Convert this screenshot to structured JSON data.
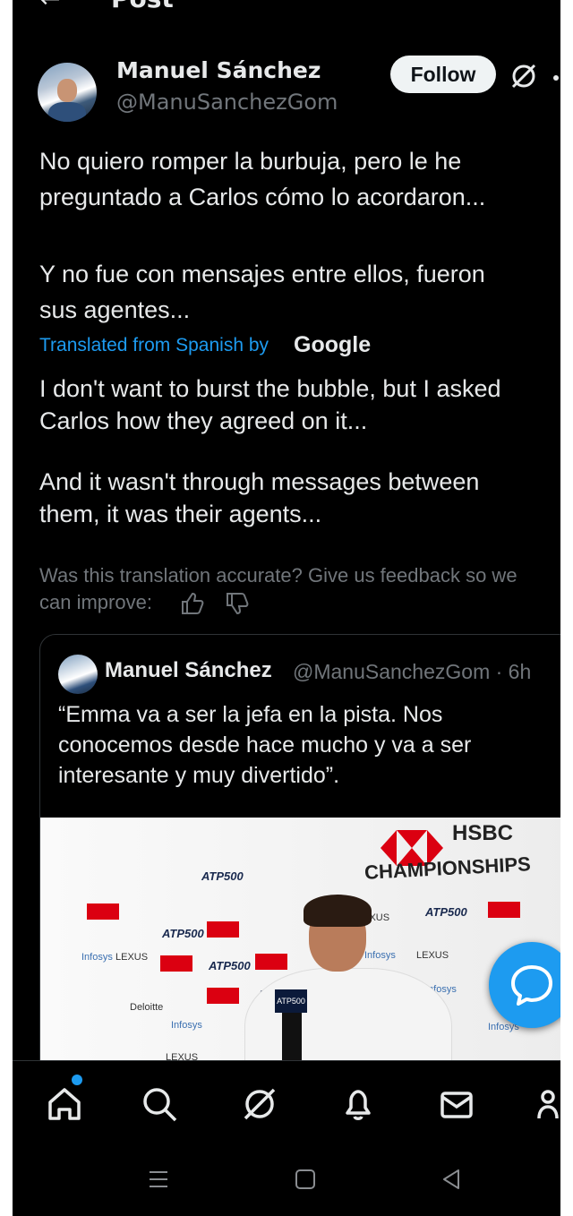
{
  "header": {
    "back_label": "←",
    "title": "Post"
  },
  "post": {
    "author_name": "Manuel Sánchez",
    "author_handle": "@ManuSanchezGom",
    "follow_label": "Follow",
    "text_lines": [
      "No quiero romper la burbuja, pero le he",
      "preguntado a Carlos cómo lo acordaron...",
      "Y no fue con mensajes entre ellos, fueron",
      "sus agentes..."
    ],
    "translated_label": "Translated from Spanish by",
    "translated_provider": "Google",
    "translation_lines": [
      "I don't want to burst the bubble, but I asked",
      "Carlos how they agreed on it...",
      "And it wasn't through messages between",
      "them, it was their agents..."
    ],
    "feedback_lines": [
      "Was this translation accurate? Give us feedback so we",
      "can improve:"
    ]
  },
  "quote": {
    "author_name": "Manuel Sánchez",
    "author_handle": "@ManuSanchezGom · 6h",
    "text_lines": [
      "“Emma va a ser la jefa en la pista. Nos",
      "conocemos desde hace mucho y va a ser",
      "interesante y muy divertido”."
    ],
    "media": {
      "brand": "HSBC",
      "event": "CHAMPIONSHIPS",
      "atp": "ATP500",
      "sponsors": [
        "Infosys",
        "LEXUS",
        "HSBC",
        "Deloitte"
      ]
    }
  },
  "nav": {
    "items": [
      "home-icon",
      "search-icon",
      "grok-icon",
      "notifications-icon",
      "messages-icon",
      "communities-icon"
    ]
  },
  "colors": {
    "accent": "#1d9bf0",
    "background": "#000000",
    "text": "#e7e9ea",
    "muted": "#71767b"
  }
}
